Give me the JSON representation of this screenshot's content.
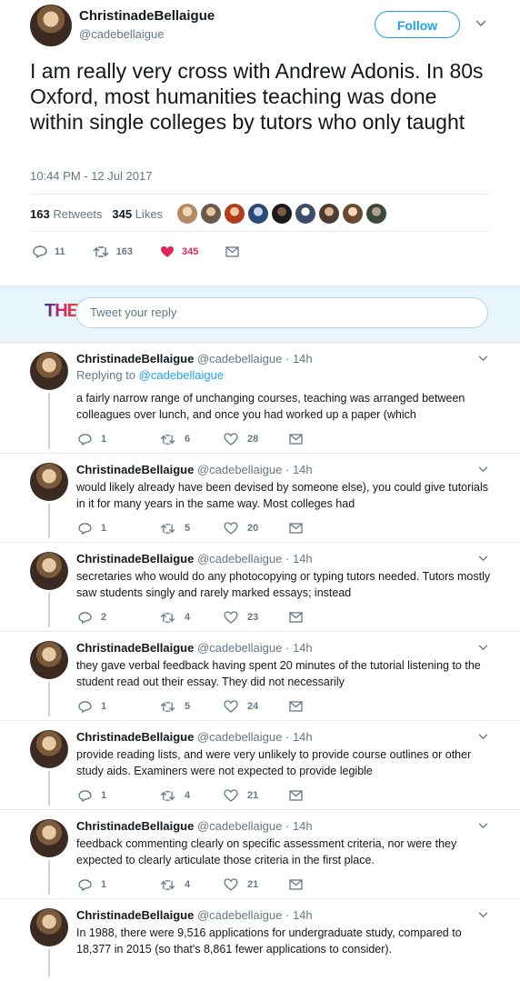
{
  "tweet": {
    "author_name": "ChristinadeBellaigue",
    "author_handle": "@cadebellaigue",
    "follow_label": "Follow",
    "text": "I am really very cross with Andrew Adonis. In 80s Oxford, most humanities teaching was done within single colleges by tutors who only taught",
    "timestamp": "10:44 PM - 12 Jul 2017",
    "retweets_count": "163",
    "retweets_label": "Retweets",
    "likes_count": "345",
    "likes_label": "Likes",
    "actions": {
      "replies": "11",
      "retweets": "163",
      "likes": "345"
    }
  },
  "reply_box": {
    "logo": "THE",
    "placeholder": "Tweet your reply"
  },
  "replies": [
    {
      "name": "ChristinadeBellaigue",
      "handle": "@cadebellaigue",
      "time": "· 14h",
      "replying_prefix": "Replying to ",
      "replying_to": "@cadebellaigue",
      "text": "a fairly narrow range of unchanging courses, teaching was arranged between colleagues over lunch, and once you had worked up a paper (which",
      "replies": "1",
      "retweets": "6",
      "likes": "28"
    },
    {
      "name": "ChristinadeBellaigue",
      "handle": "@cadebellaigue",
      "time": "· 14h",
      "text": "would likely already have been devised by someone else), you could give tutorials in it for many years in the same way.  Most colleges had",
      "replies": "1",
      "retweets": "5",
      "likes": "20"
    },
    {
      "name": "ChristinadeBellaigue",
      "handle": "@cadebellaigue",
      "time": "· 14h",
      "text": "secretaries who would do any photocopying or typing tutors needed. Tutors mostly saw students singly and rarely marked essays; instead",
      "replies": "2",
      "retweets": "4",
      "likes": "23"
    },
    {
      "name": "ChristinadeBellaigue",
      "handle": "@cadebellaigue",
      "time": "· 14h",
      "text": "they gave verbal feedback having spent 20 minutes of the tutorial listening to the student read out their essay. They did not necessarily",
      "replies": "1",
      "retweets": "5",
      "likes": "24"
    },
    {
      "name": "ChristinadeBellaigue",
      "handle": "@cadebellaigue",
      "time": "· 14h",
      "text": "provide reading lists, and were very unlikely to provide course outlines or other study aids. Examiners were not expected to provide legible",
      "replies": "1",
      "retweets": "4",
      "likes": "21"
    },
    {
      "name": "ChristinadeBellaigue",
      "handle": "@cadebellaigue",
      "time": "· 14h",
      "text": "feedback commenting clearly on specific assessment criteria, nor were they expected to clearly articulate those criteria in the first place.",
      "replies": "1",
      "retweets": "4",
      "likes": "21"
    },
    {
      "name": "ChristinadeBellaigue",
      "handle": "@cadebellaigue",
      "time": "· 14h",
      "text": "In 1988, there were 9,516 applications for undergraduate study, compared to 18,377 in 2015 (so that's 8,861 fewer applications to consider)."
    }
  ],
  "colors": {
    "accent": "#1da1f2",
    "like": "#e0245e",
    "muted": "#657786",
    "thread": "#ccd6dd"
  },
  "icons": [
    "reply-icon",
    "retweet-icon",
    "heart-icon",
    "message-icon",
    "chevron-down-icon"
  ]
}
